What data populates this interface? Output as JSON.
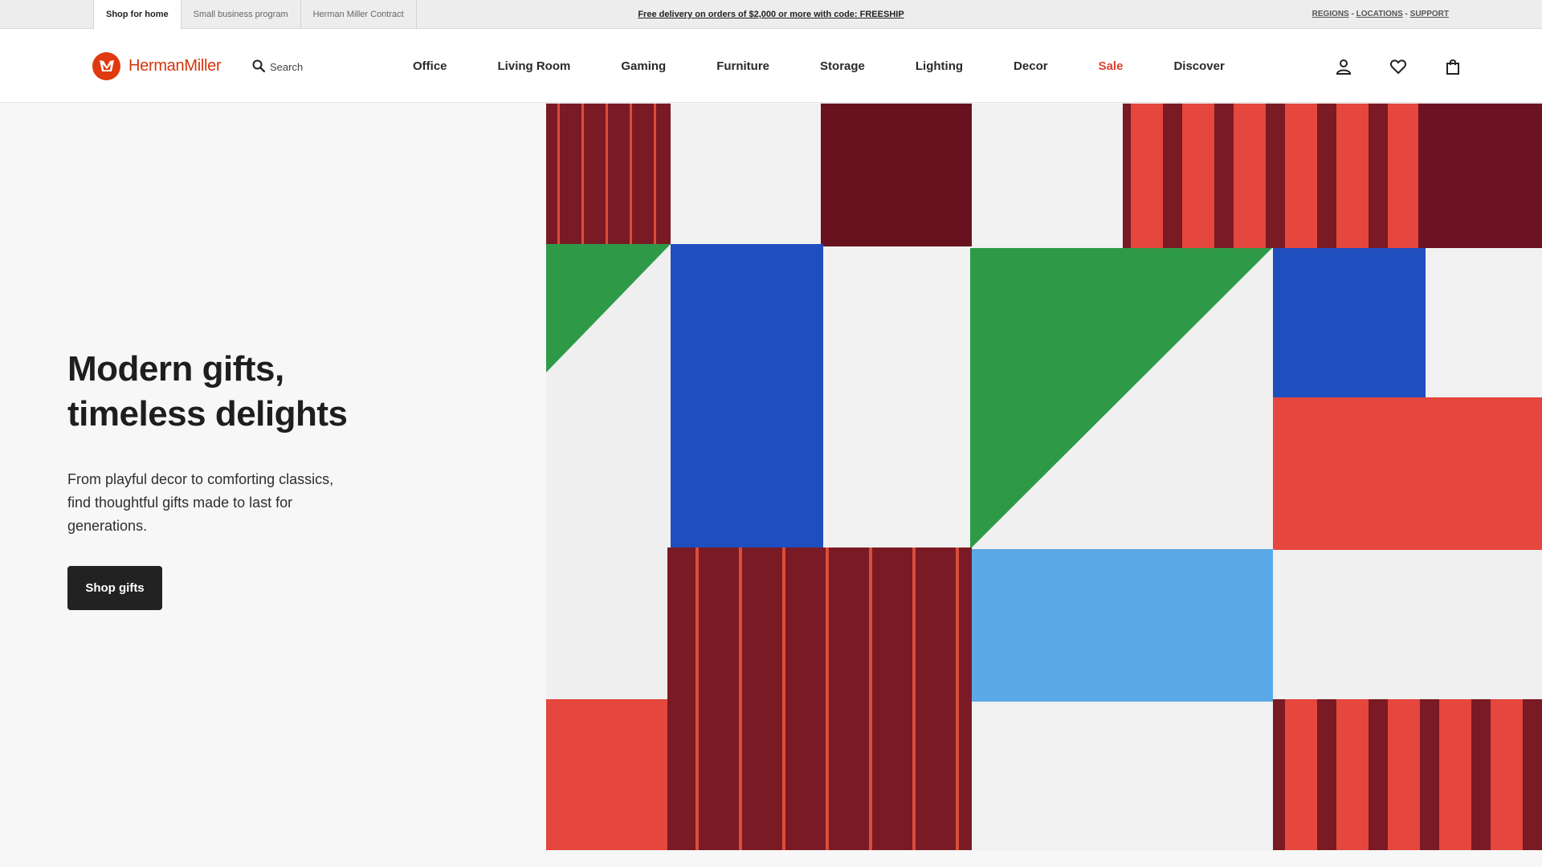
{
  "utility": {
    "tabs": [
      "Shop for home",
      "Small business program",
      "Herman Miller Contract"
    ],
    "promo": "Free delivery on orders of $2,000 or more with code: FREESHIP",
    "links": {
      "regions": "REGIONS",
      "locations": "LOCATIONS",
      "support": "SUPPORT",
      "separator": " - "
    }
  },
  "header": {
    "logo_text": "HermanMiller",
    "search_label": "Search",
    "nav": [
      "Office",
      "Living Room",
      "Gaming",
      "Furniture",
      "Storage",
      "Lighting",
      "Decor",
      "Sale",
      "Discover"
    ],
    "icons": [
      "account-icon",
      "wishlist-heart-icon",
      "shopping-bag-icon"
    ]
  },
  "hero": {
    "title_line1": "Modern gifts,",
    "title_line2": "timeless delights",
    "subtitle": "From playful decor to comforting classics, find thoughtful gifts made to last for generations.",
    "cta": "Shop gifts"
  },
  "colors": {
    "brand": "#d4360d",
    "sale": "#d9432f",
    "art_maroon": "#7a1a24",
    "art_red": "#e5463d",
    "art_green": "#2e9a48",
    "art_blue": "#1f4ebf",
    "art_light_blue": "#5ba9e6"
  }
}
